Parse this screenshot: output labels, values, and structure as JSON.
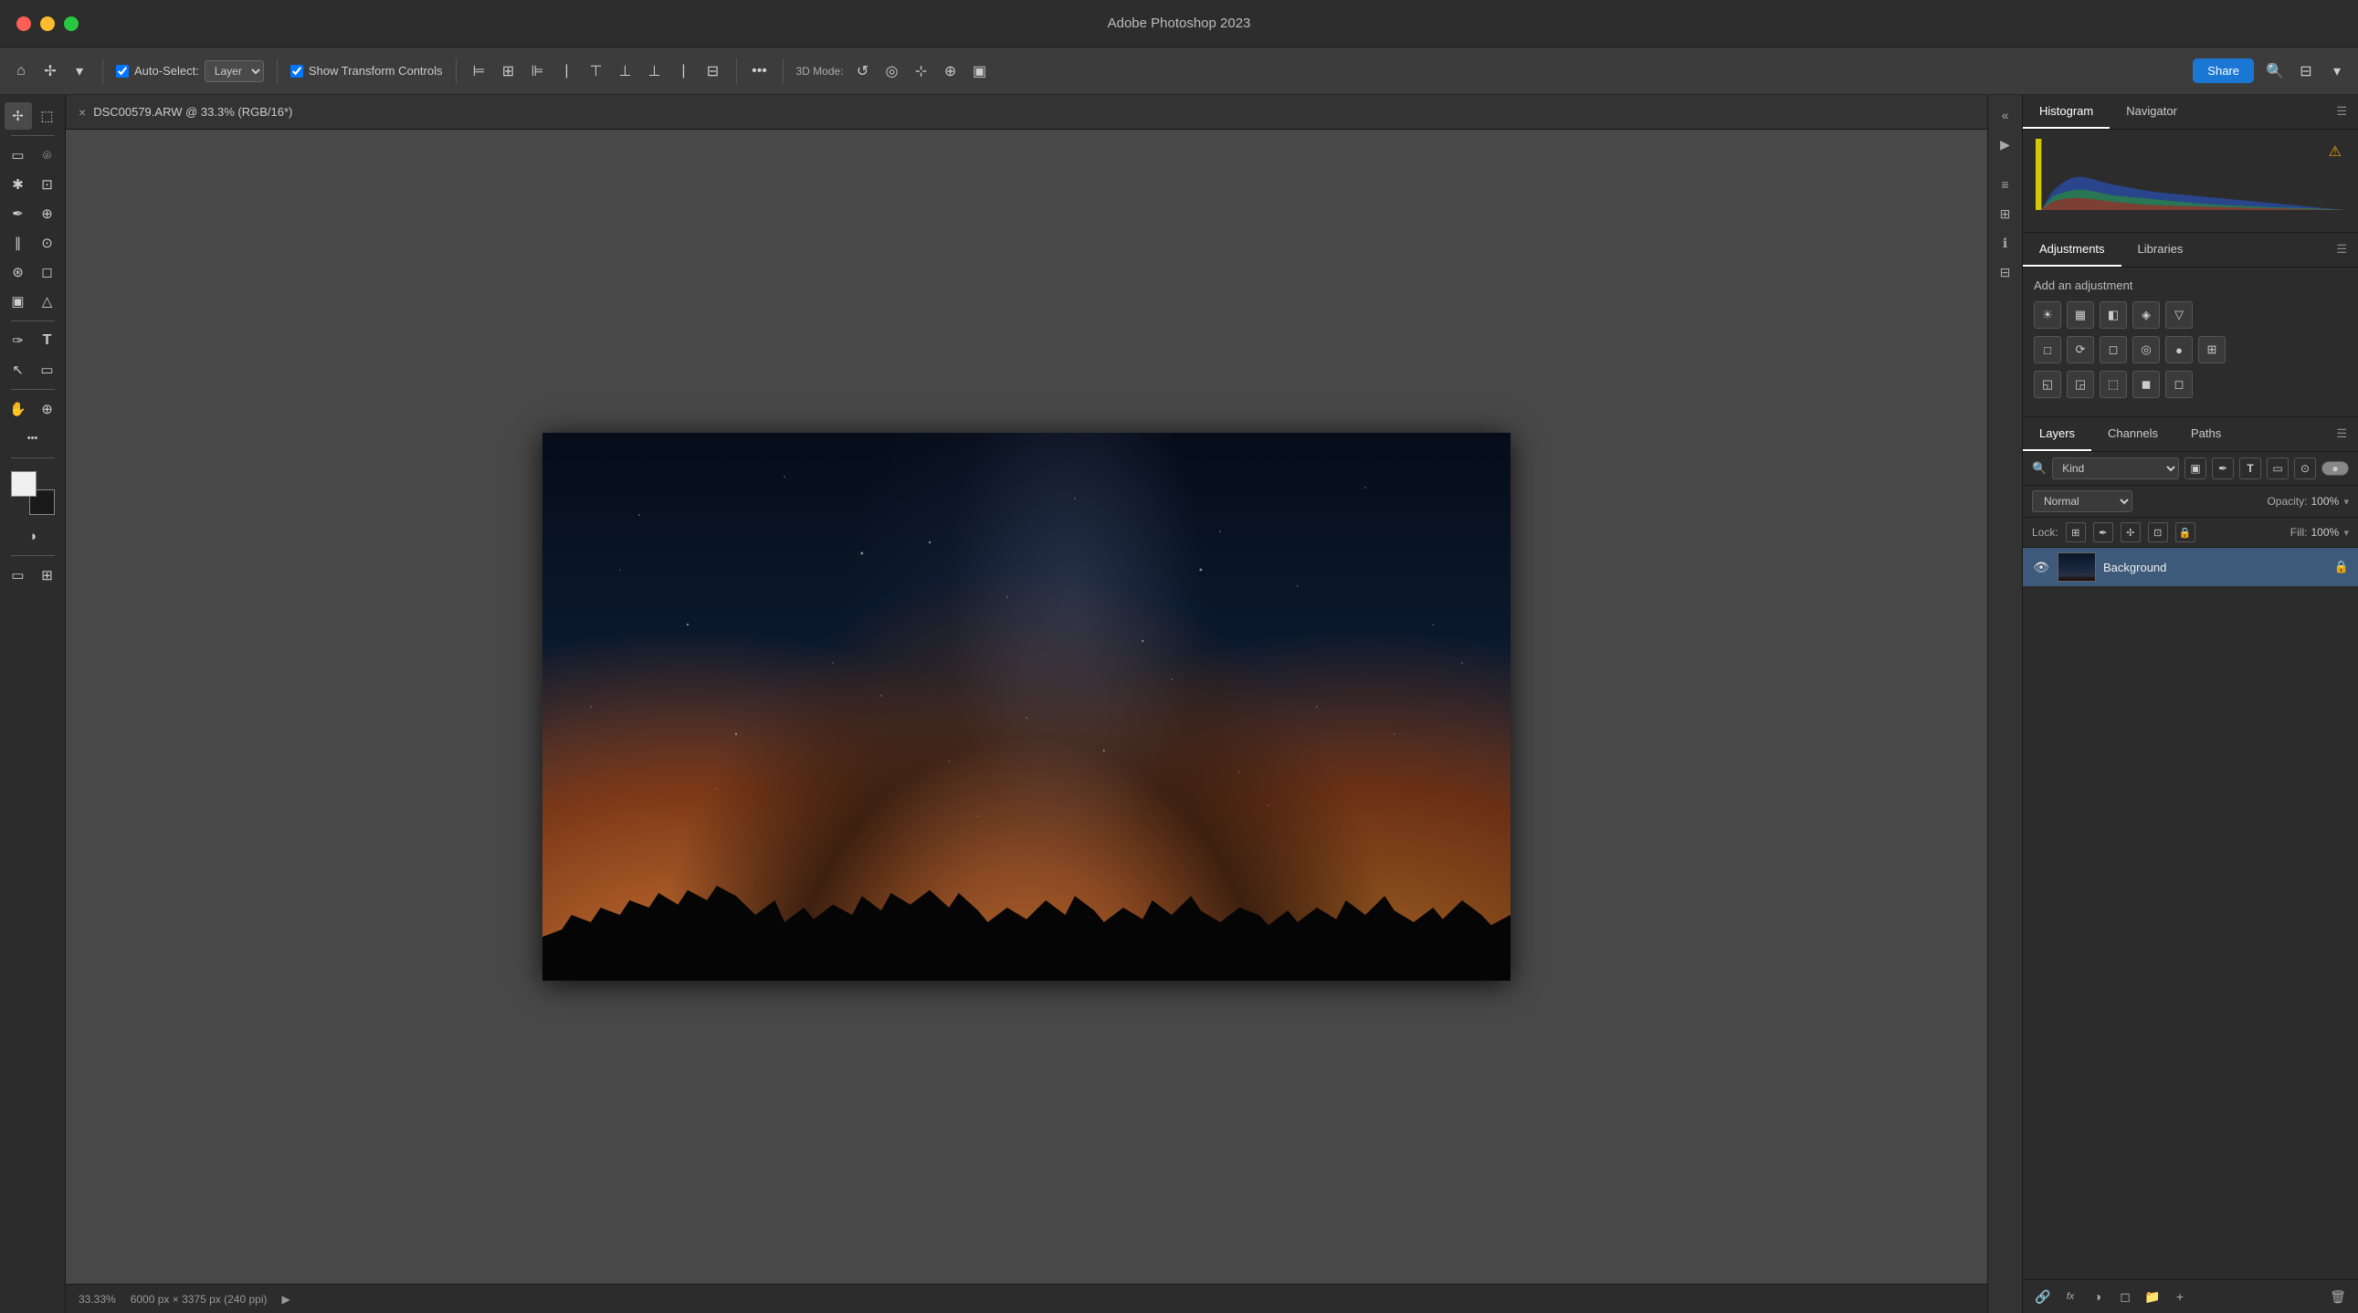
{
  "app": {
    "title": "Adobe Photoshop 2023",
    "window_controls": [
      "close",
      "minimize",
      "maximize"
    ]
  },
  "titlebar": {
    "title": "Adobe Photoshop 2023"
  },
  "toolbar": {
    "auto_select_label": "Auto-Select:",
    "layer_option": "Layer",
    "show_transform_label": "Show Transform Controls",
    "three_d_mode_label": "3D Mode:",
    "share_label": "Share",
    "more_icon": "•••",
    "search_icon": "🔍"
  },
  "canvas_tab": {
    "title": "DSC00579.ARW @ 33.3% (RGB/16*)",
    "close": "×"
  },
  "status_bar": {
    "zoom": "33.33%",
    "dimensions": "6000 px × 3375 px (240 ppi)",
    "arrow": "▶"
  },
  "histogram_panel": {
    "tabs": [
      "Histogram",
      "Navigator"
    ],
    "warning_icon": "⚠"
  },
  "adjustments_panel": {
    "tabs": [
      "Adjustments",
      "Libraries"
    ],
    "add_adjustment_label": "Add an adjustment",
    "icons_row1": [
      "☀",
      "▦",
      "◧",
      "◈",
      "▽"
    ],
    "icons_row2": [
      "□",
      "⟳",
      "◻",
      "◎",
      "●",
      "⊞"
    ],
    "icons_row3": [
      "◱",
      "◲",
      "⬚",
      "◼",
      "◻"
    ]
  },
  "layers_panel": {
    "tabs": [
      "Layers",
      "Channels",
      "Paths"
    ],
    "filter_label": "Kind",
    "blend_mode": "Normal",
    "opacity_label": "Opacity:",
    "opacity_value": "100%",
    "lock_label": "Lock:",
    "fill_label": "Fill:",
    "fill_value": "100%",
    "layers": [
      {
        "name": "Background",
        "visible": true,
        "locked": true
      }
    ],
    "footer_icons": [
      "🔗",
      "fx",
      "◑",
      "◻",
      "📁",
      "🗑"
    ]
  },
  "left_tools": {
    "tools": [
      {
        "name": "move",
        "icon": "✢"
      },
      {
        "name": "select-rect",
        "icon": "▭"
      },
      {
        "name": "lasso",
        "icon": "⌾"
      },
      {
        "name": "quick-select",
        "icon": "✱"
      },
      {
        "name": "crop",
        "icon": "⊡"
      },
      {
        "name": "eyedropper",
        "icon": "✒"
      },
      {
        "name": "healing",
        "icon": "⊕"
      },
      {
        "name": "brush",
        "icon": "∥"
      },
      {
        "name": "clone-stamp",
        "icon": "⊙"
      },
      {
        "name": "history-brush",
        "icon": "⊛"
      },
      {
        "name": "eraser",
        "icon": "◻"
      },
      {
        "name": "gradient",
        "icon": "▣"
      },
      {
        "name": "dodge",
        "icon": "△"
      },
      {
        "name": "pen",
        "icon": "✑"
      },
      {
        "name": "text",
        "icon": "T"
      },
      {
        "name": "path-select",
        "icon": "↖"
      },
      {
        "name": "shape",
        "icon": "▭"
      },
      {
        "name": "hand",
        "icon": "✋"
      },
      {
        "name": "zoom",
        "icon": "⊕"
      },
      {
        "name": "more",
        "icon": "•••"
      }
    ]
  },
  "colors": {
    "background": "#3a3a3a",
    "panel_bg": "#2c2c2c",
    "toolbar_bg": "#3c3c3c",
    "left_panel_bg": "#2c2c2c",
    "accent_blue": "#1a77d4",
    "layer_selected": "#3d5a7a",
    "tab_active_color": "#ffffff",
    "histogram_blue": "#1a4a8a",
    "histogram_green": "#1a6a2a",
    "histogram_red": "#6a1a1a",
    "histogram_yellow": "#d4b000"
  }
}
